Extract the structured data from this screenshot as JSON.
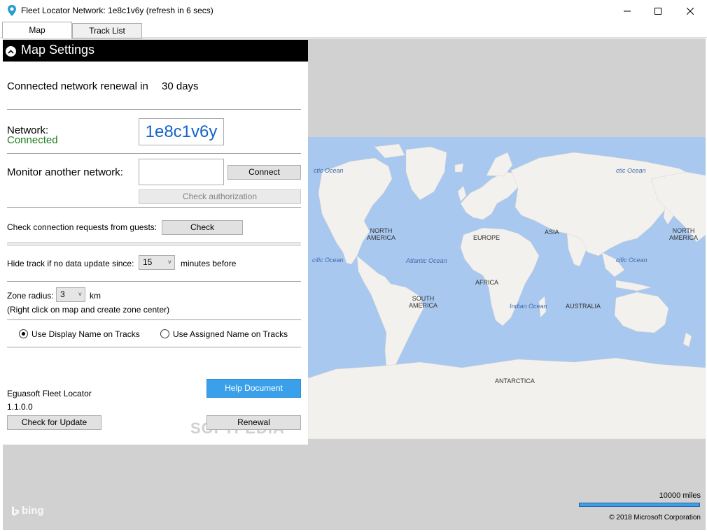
{
  "window": {
    "title": "Fleet Locator Network: 1e8c1v6y (refresh in 6 secs)",
    "minimize_glyph": "—",
    "maximize_glyph": "☐",
    "close_glyph": "✕"
  },
  "tabs": [
    {
      "label": "Map",
      "selected": true
    },
    {
      "label": "Track List",
      "selected": false
    }
  ],
  "panel": {
    "title": "Map Settings",
    "renewal_text": "Connected network renewal in",
    "renewal_days": "30 days",
    "network_label": "Network:",
    "network_status": "Connected",
    "network_id": "1e8c1v6y",
    "monitor_label": "Monitor another network:",
    "monitor_input_value": "",
    "connect_button": "Connect",
    "check_auth_button": "Check authorization",
    "guest_label": "Check connection requests from guests:",
    "check_button": "Check",
    "hide_track_label": "Hide track if no data update since:",
    "hide_track_value": "15",
    "hide_track_suffix": "minutes before",
    "zone_label": "Zone radius:",
    "zone_value": "3",
    "zone_unit": "km",
    "zone_hint": "(Right click on map and create zone center)",
    "radio_display": "Use Display Name on Tracks",
    "radio_assigned": "Use Assigned Name on Tracks",
    "radio_selected": "display",
    "app_name": "Eguasoft Fleet Locator",
    "version": "1.1.0.0",
    "help_button": "Help Document",
    "update_button": "Check for Update",
    "renewal_button": "Renewal"
  },
  "map": {
    "ocean_labels": [
      "ctic Ocean",
      "ctic Ocean",
      "cific Ocean",
      "Atlantic Ocean",
      "cific Ocean",
      "Indian Ocean"
    ],
    "continent_labels": [
      "NORTH\nAMERICA",
      "EUROPE",
      "ASIA",
      "NORTH\nAMERICA",
      "AFRICA",
      "SOUTH\nAMERICA",
      "AUSTRALIA",
      "ANTARCTICA"
    ],
    "scale_text": "10000 miles",
    "copyright": "© 2018 Microsoft Corporation",
    "provider": "bing",
    "watermark": "SOFTPEDIA"
  },
  "colors": {
    "water": "#a8c8f0",
    "land": "#f3f1ee",
    "accent": "#3aa0ea",
    "network_id": "#1464c8",
    "status_green": "#1e7d1e"
  }
}
